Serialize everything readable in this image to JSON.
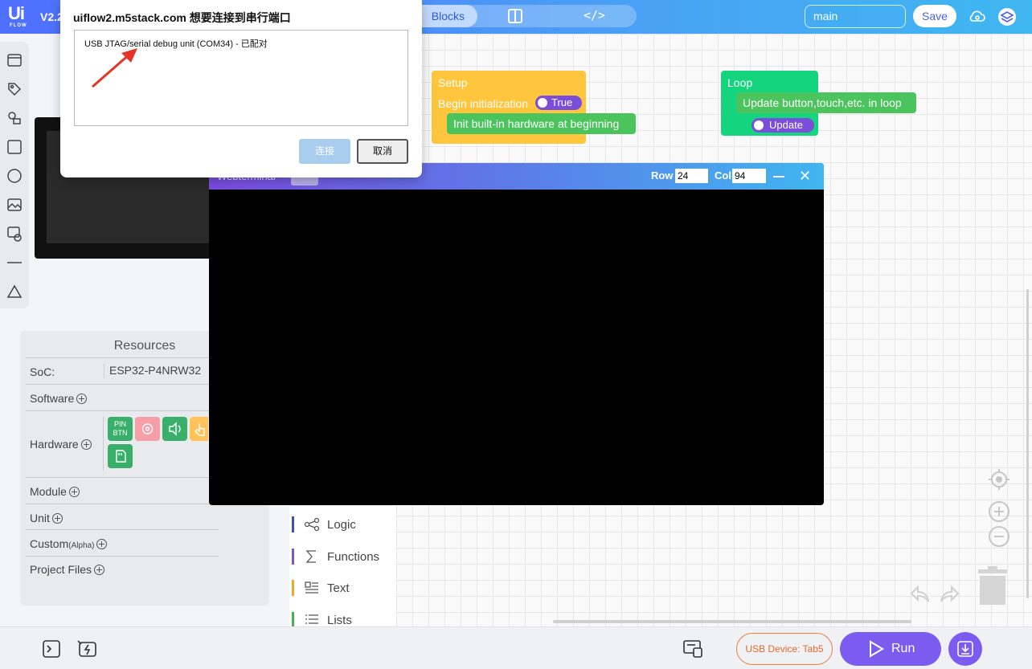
{
  "header": {
    "logo_text": "Ui",
    "logo_sub": "FLOW",
    "version": "V2.2",
    "tab_blocks": "Blocks",
    "tab_code": "</>",
    "branch": "main",
    "save_label": "Save"
  },
  "resources": {
    "title": "Resources",
    "soc_label": "SoC:",
    "soc_value": "ESP32-P4NRW32",
    "software": "Software",
    "hardware": "Hardware",
    "pin_btn": "PIN\nBTN",
    "module": "Module",
    "unit": "Unit",
    "custom": "Custom",
    "custom_tag": "(Alpha)",
    "project_files": "Project Files"
  },
  "blocks": {
    "setup_label": "Setup",
    "begin_init": "Begin initialization",
    "true_label": "True",
    "init_hw": "Init built-in hardware at beginning",
    "loop_label": "Loop",
    "update_loop": "Update button,touch,etc. in loop",
    "update_label": "Update"
  },
  "categories": [
    {
      "label": "Logic",
      "color": "#3f51b5"
    },
    {
      "label": "Functions",
      "color": "#7e57c2"
    },
    {
      "label": "Text",
      "color": "#f5a623"
    },
    {
      "label": "Lists",
      "color": "#4caf50"
    }
  ],
  "terminal": {
    "title": "Webterminal",
    "row_label": "Row",
    "row_value": "24",
    "col_label": "Col",
    "col_value": "94"
  },
  "dialog": {
    "title": "uiflow2.m5stack.com 想要连接到串行端口",
    "device": "USB JTAG/serial debug unit (COM34) - 已配对",
    "connect_label": "连接",
    "cancel_label": "取消"
  },
  "bottom": {
    "usb_device": "USB Device: Tab5",
    "run_label": "Run"
  },
  "colors": {
    "accent": "#7c5cf0",
    "setup_block": "#ffc53d",
    "loop_block": "#14d47e",
    "inner_block": "#4cc45e",
    "usb_border": "#f07f3c"
  }
}
